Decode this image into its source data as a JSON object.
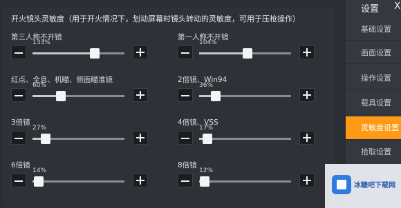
{
  "header": "开火镜头灵敏度（用于开火情况下，划动屏幕时镜头转动的灵敏度，可用于压枪操作）",
  "sliders": [
    {
      "label": "第三人称不开镜",
      "value": "133%",
      "level": 0.68
    },
    {
      "label": "第一人称不开镜",
      "value": "104%",
      "level": 0.53
    },
    {
      "label": "红点、全息、机瞄、侧面瞄准镜",
      "value": "60%",
      "level": 0.31
    },
    {
      "label": "2倍镜、Win94",
      "value": "36%",
      "level": 0.18
    },
    {
      "label": "3倍镜",
      "value": "27%",
      "level": 0.14
    },
    {
      "label": "4倍镜、VSS",
      "value": "17%",
      "level": 0.09
    },
    {
      "label": "6倍镜",
      "value": "14%",
      "level": 0.07
    },
    {
      "label": "8倍镜",
      "value": "12%",
      "level": 0.06
    }
  ],
  "sidebar": {
    "title": "设置",
    "close": "X",
    "items": [
      "基础设置",
      "画面设置",
      "操作设置",
      "载具设置",
      "灵敏度设置",
      "拾取设置"
    ],
    "active_index": 4
  },
  "watermark": {
    "text": "冰糖吧下载网"
  },
  "colors": {
    "accent": "#ff9a14",
    "panel": "#303238",
    "sidebar": "#35383e"
  }
}
